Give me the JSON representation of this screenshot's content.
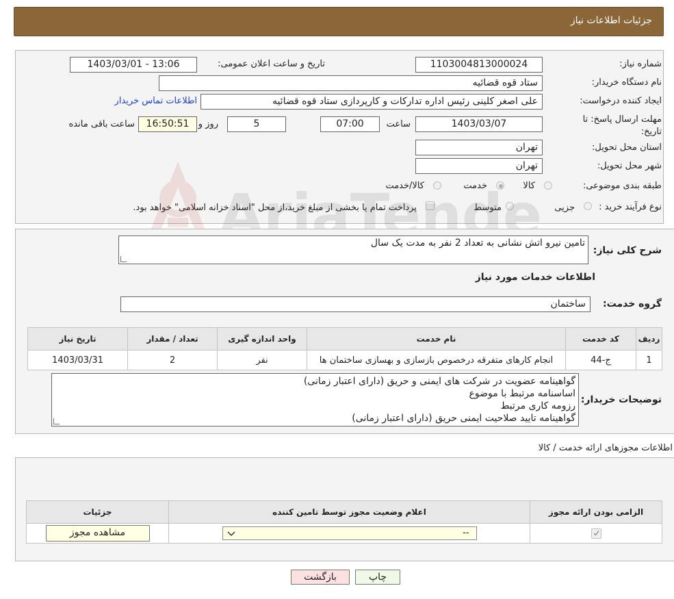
{
  "header": {
    "title": "جزئیات اطلاعات نیاز"
  },
  "need": {
    "number_label": "شماره نیاز:",
    "number": "1103004813000024",
    "announce_label": "تاریخ و ساعت اعلان عمومی:",
    "announce_value": "1403/03/01 - 13:06",
    "buyer_org_label": "نام دستگاه خریدار:",
    "buyer_org": "ستاد قوه قضائیه",
    "creator_label": "ایجاد کننده درخواست:",
    "creator": "علی اصغر کلینی رئیس اداره تدارکات و کارپردازی ستاد قوه قضائیه",
    "contact_link": "اطلاعات تماس خریدار",
    "deadline_label": "مهلت ارسال پاسخ: تا تاریخ:",
    "deadline_date": "1403/03/07",
    "time_label": "ساعت",
    "deadline_time": "07:00",
    "days_value": "5",
    "days_label": "روز و",
    "remaining_time": "16:50:51",
    "remaining_label": "ساعت باقی مانده",
    "province_label": "استان محل تحویل:",
    "province": "تهران",
    "city_label": "شهر محل تحویل:",
    "city": "تهران",
    "category_label": "طبقه بندی موضوعی:",
    "category_options": [
      "کالا",
      "خدمت",
      "کالا/خدمت"
    ],
    "purchase_type_label": "نوع فرآیند خرید :",
    "purchase_options": [
      "جزیی",
      "متوسط"
    ],
    "purchase_note": "پرداخت تمام یا بخشی از مبلغ خرید،از محل \"اسناد خزانه اسلامی\" خواهد بود."
  },
  "description": {
    "label": "شرح کلی نیاز:",
    "value": "تامین نیرو اتش نشانی به تعداد 2 نفر به مدت یک سال"
  },
  "services": {
    "title": "اطلاعات خدمات مورد نیاز",
    "group_label": "گروه خدمت:",
    "group_value": "ساختمان",
    "columns": [
      "ردیف",
      "کد خدمت",
      "نام خدمت",
      "واحد اندازه گیری",
      "تعداد / مقدار",
      "تاریخ نیاز"
    ],
    "rows": [
      {
        "index": "1",
        "code": "ج-44",
        "name": "انجام کارهای متفرقه درخصوص بازسازی و بهسازی ساختمان ها",
        "unit": "نفر",
        "qty": "2",
        "date": "1403/03/31"
      }
    ]
  },
  "buyer_notes": {
    "label": "توضیحات خریدار:",
    "lines": [
      "گواهینامه عضویت در شرکت های ایمنی و حریق (دارای اعتبار زمانی)",
      "اساسنامه مرتبط با موضوع",
      "رزومه کاری مرتبط",
      "گواهینامه تایید صلاحیت ایمنی حریق (دارای اعتبار زمانی)"
    ]
  },
  "permits": {
    "title": "اطلاعات مجوزهای ارائه خدمت / کالا",
    "columns": [
      "الزامی بودن ارائه مجوز",
      "اعلام وضعیت مجوز توسط تامین کننده",
      "جزئیات"
    ],
    "select_value": "--",
    "view_button": "مشاهده مجوز"
  },
  "buttons": {
    "print": "چاپ",
    "back": "بازگشت"
  },
  "watermark": {
    "text": "AriaTender.net"
  },
  "colors": {
    "header_bg": "#8a6638",
    "link": "#1a3fd6",
    "back_btn": "#fde0e0",
    "print_btn": "#eef9e6"
  }
}
